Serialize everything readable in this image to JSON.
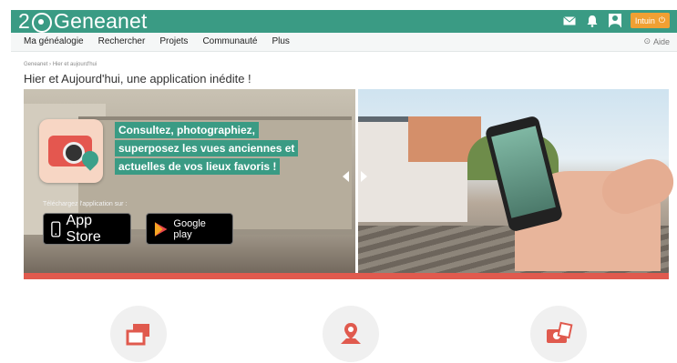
{
  "brand": {
    "logo_left": "2",
    "logo_right": "Geneanet",
    "user_label": "Intuin"
  },
  "nav": {
    "items": [
      "Ma généalogie",
      "Rechercher",
      "Projets",
      "Communauté",
      "Plus"
    ],
    "help": "Aide"
  },
  "breadcrumb": "Geneanet › Hier et aujourd'hui",
  "page_title": "Hier et Aujourd'hui, une application inédite !",
  "banner": {
    "tagline": [
      "Consultez, photographiez,",
      "superposez les vues anciennes et",
      "actuelles de vos lieux favoris !"
    ],
    "download_label": "Téléchargez l'application sur :",
    "apple_store": "App Store",
    "google_play": "Google play"
  },
  "features": [
    {
      "icon": "windows-icon"
    },
    {
      "icon": "map-pin-icon"
    },
    {
      "icon": "camera-photo-icon"
    }
  ],
  "colors": {
    "brand_green": "#3a9b84",
    "accent_red": "#e05a4e",
    "user_orange": "#f0a033"
  }
}
